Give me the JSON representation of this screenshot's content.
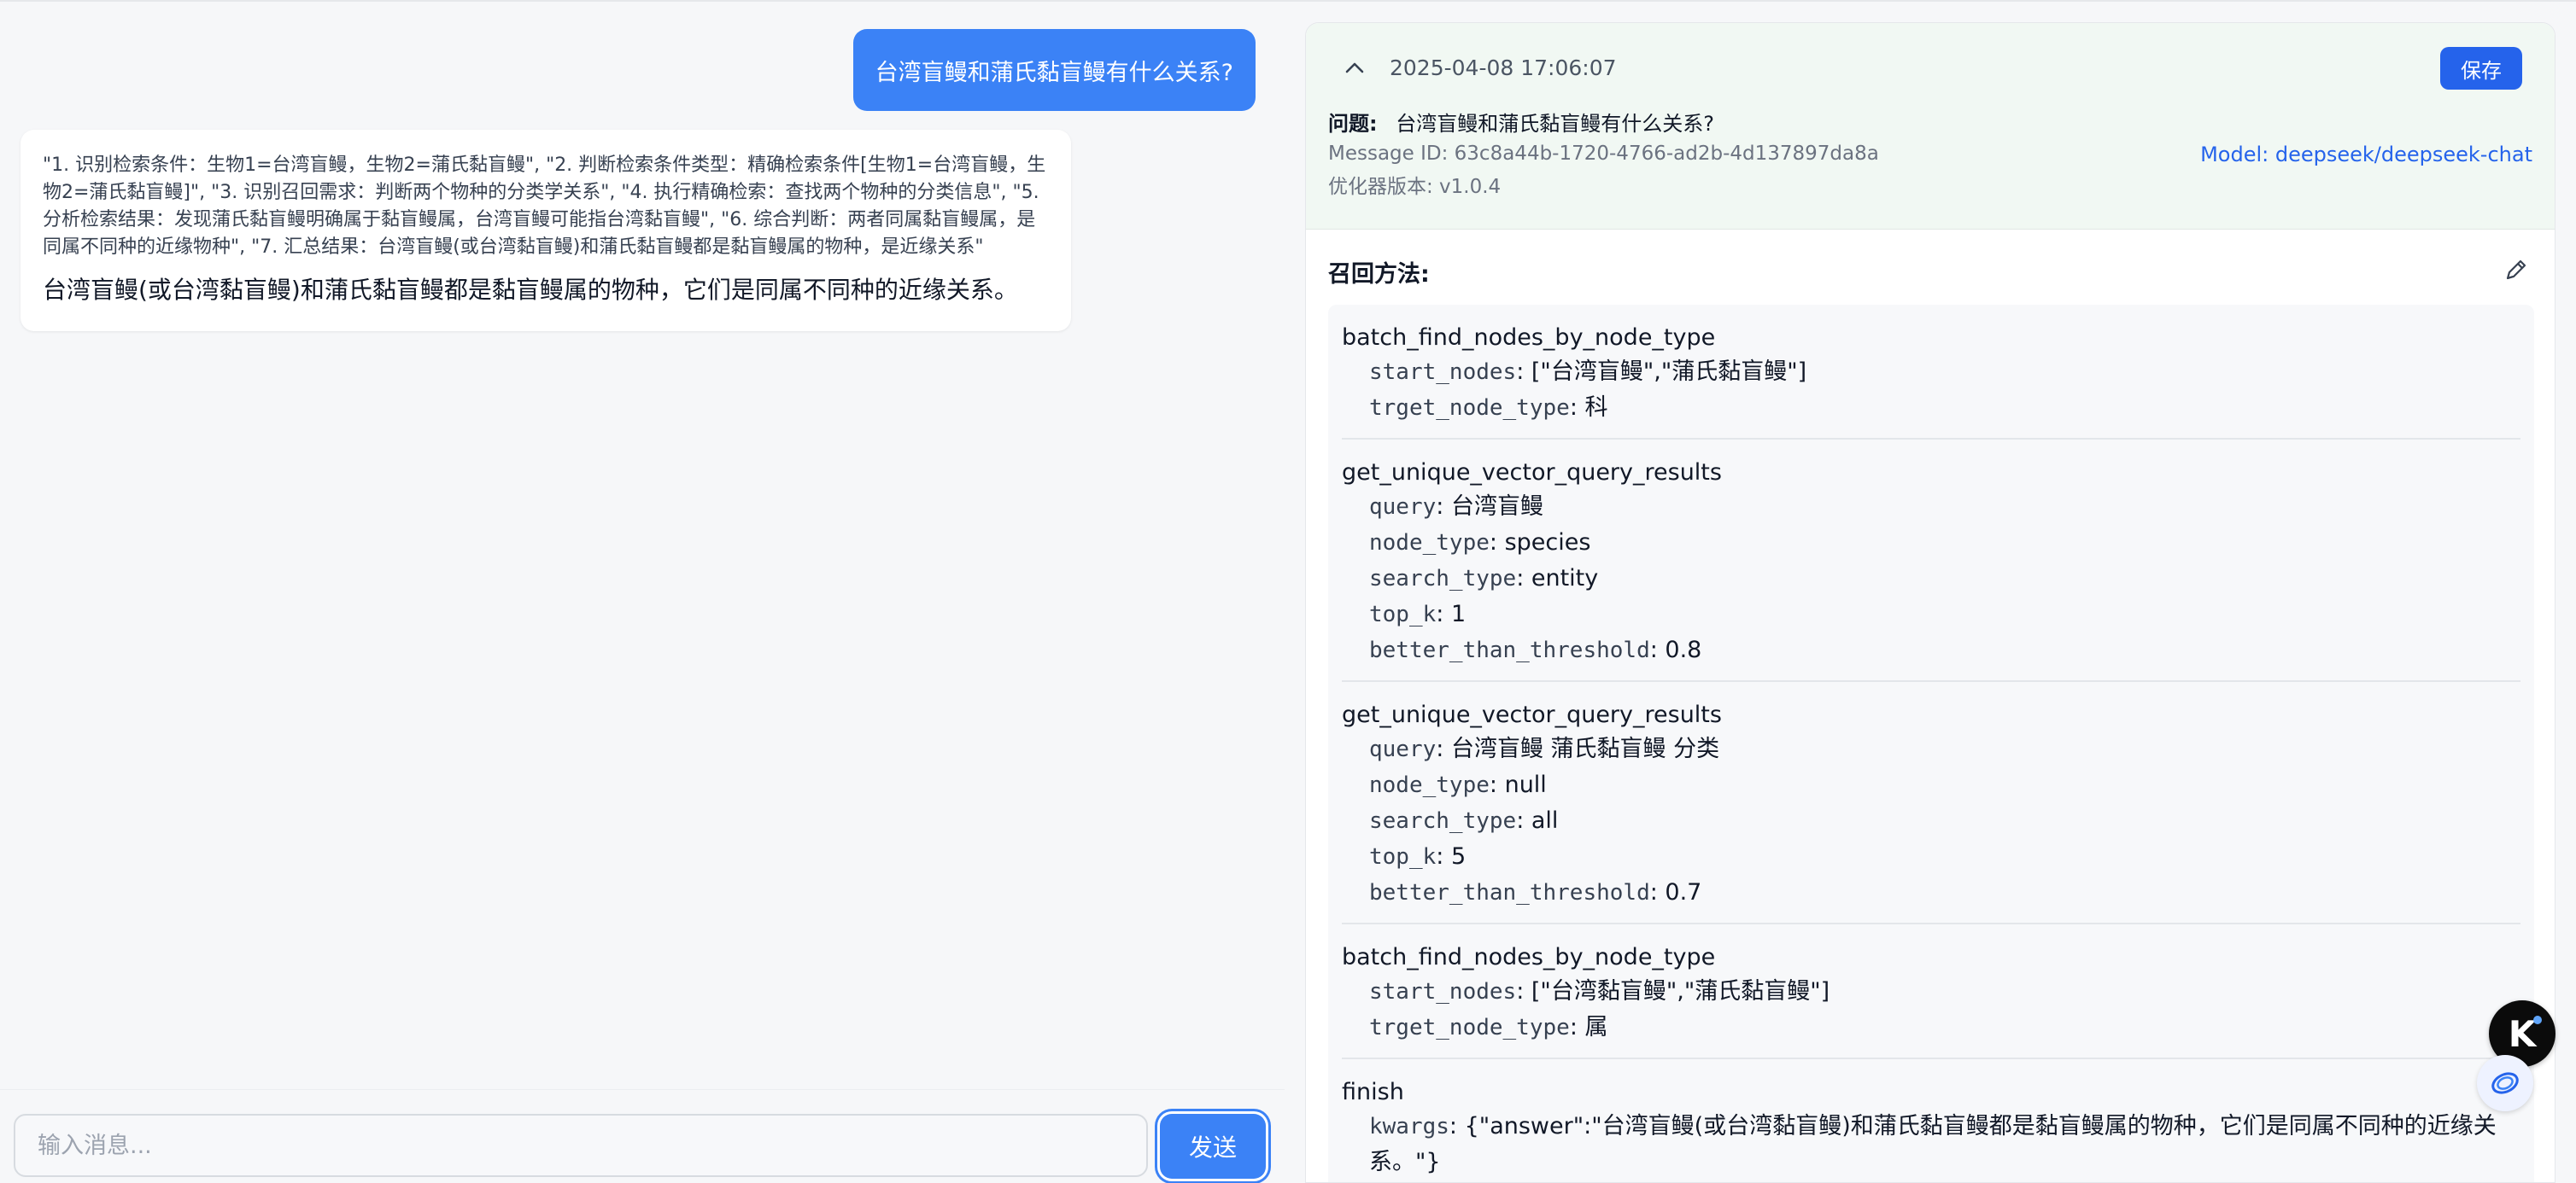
{
  "chat": {
    "user_message": "台湾盲鳗和蒲氏黏盲鳗有什么关系?",
    "bot_steps": "\"1. 识别检索条件：生物1=台湾盲鳗，生物2=蒲氏黏盲鳗\", \"2. 判断检索条件类型：精确检索条件[生物1=台湾盲鳗，生物2=蒲氏黏盲鳗]\", \"3. 识别召回需求：判断两个物种的分类学关系\", \"4. 执行精确检索：查找两个物种的分类信息\", \"5. 分析检索结果：发现蒲氏黏盲鳗明确属于黏盲鳗属，台湾盲鳗可能指台湾黏盲鳗\", \"6. 综合判断：两者同属黏盲鳗属，是同属不同种的近缘物种\", \"7. 汇总结果：台湾盲鳗(或台湾黏盲鳗)和蒲氏黏盲鳗都是黏盲鳗属的物种，是近缘关系\"",
    "bot_answer": "台湾盲鳗(或台湾黏盲鳗)和蒲氏黏盲鳗都是黏盲鳗属的物种，它们是同属不同种的近缘关系。"
  },
  "composer": {
    "placeholder": "输入消息...",
    "send_label": "发送"
  },
  "detail": {
    "timestamp": "2025-04-08 17:06:07",
    "save_label": "保存",
    "question_label": "问题:",
    "question": "台湾盲鳗和蒲氏黏盲鳗有什么关系?",
    "message_id": "Message ID: 63c8a44b-1720-4766-ad2b-4d137897da8a",
    "model": "Model: deepseek/deepseek-chat",
    "optimizer_version": "优化器版本: v1.0.4",
    "recall_title": "召回方法:"
  },
  "methods": [
    {
      "name": "batch_find_nodes_by_node_type",
      "params": [
        {
          "key": "start_nodes",
          "value": "[\"台湾盲鳗\",\"蒲氏黏盲鳗\"]"
        },
        {
          "key": "trget_node_type",
          "value": "科"
        }
      ]
    },
    {
      "name": "get_unique_vector_query_results",
      "params": [
        {
          "key": "query",
          "value": "台湾盲鳗"
        },
        {
          "key": "node_type",
          "value": "species"
        },
        {
          "key": "search_type",
          "value": "entity"
        },
        {
          "key": "top_k",
          "value": "1"
        },
        {
          "key": "better_than_threshold",
          "value": "0.8"
        }
      ]
    },
    {
      "name": "get_unique_vector_query_results",
      "params": [
        {
          "key": "query",
          "value": "台湾盲鳗 蒲氏黏盲鳗 分类"
        },
        {
          "key": "node_type",
          "value": "null"
        },
        {
          "key": "search_type",
          "value": "all"
        },
        {
          "key": "top_k",
          "value": "5"
        },
        {
          "key": "better_than_threshold",
          "value": "0.7"
        }
      ]
    },
    {
      "name": "batch_find_nodes_by_node_type",
      "params": [
        {
          "key": "start_nodes",
          "value": "[\"台湾黏盲鳗\",\"蒲氏黏盲鳗\"]"
        },
        {
          "key": "trget_node_type",
          "value": "属"
        }
      ]
    },
    {
      "name": "finish",
      "params": [
        {
          "key": "kwargs",
          "value": "{\"answer\":\"台湾盲鳗(或台湾黏盲鳗)和蒲氏黏盲鳗都是黏盲鳗属的物种，它们是同属不同种的近缘关系。\"}"
        }
      ]
    }
  ],
  "floating": {
    "k_glyph": "K"
  },
  "colors": {
    "accent": "#3b82f6",
    "save_button": "#2563eb",
    "meta_bg": "#f1f8f3",
    "model_link": "#2563eb"
  },
  "icons": [
    "chevron-up-icon",
    "edit-pencil-icon",
    "k-assistant-icon",
    "ai-assistant-icon"
  ]
}
